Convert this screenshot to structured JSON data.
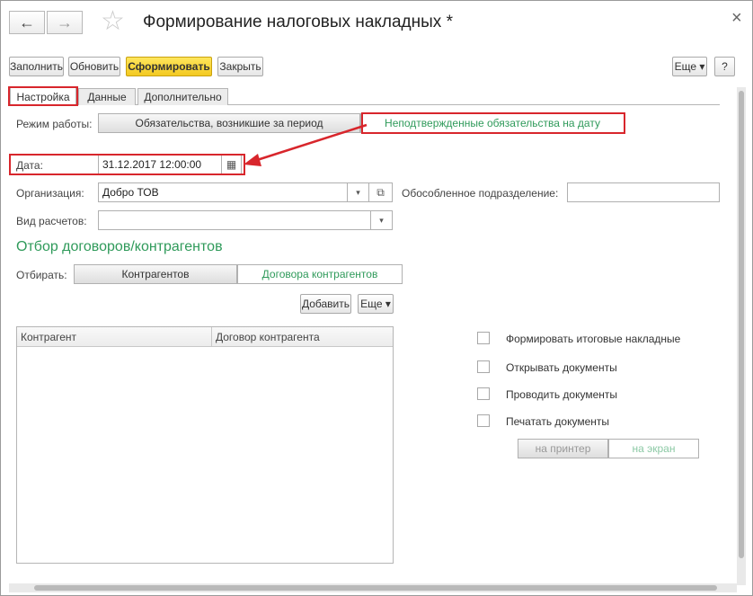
{
  "window": {
    "title": "Формирование налоговых накладных *",
    "close_glyph": "×"
  },
  "nav": {
    "back_glyph": "←",
    "forward_glyph": "→",
    "favorite_glyph": "☆"
  },
  "toolbar": {
    "fill_label": "Заполнить",
    "refresh_label": "Обновить",
    "generate_label": "Сформировать",
    "close_label": "Закрыть",
    "more_label": "Еще ▾",
    "help_label": "?"
  },
  "tabs": [
    {
      "label": "Настройка",
      "active": true
    },
    {
      "label": "Данные",
      "active": false
    },
    {
      "label": "Дополнительно",
      "active": false
    }
  ],
  "form": {
    "mode_label": "Режим работы:",
    "mode_options": [
      "Обязательства, возникшие за период",
      "Неподтвержденные обязательства на дату"
    ],
    "date_label": "Дата:",
    "date_value": "31.12.2017 12:00:00",
    "calendar_icon": "▦",
    "org_label": "Организация:",
    "org_value": "Добро ТОВ",
    "dropdown_glyph": "▾",
    "open_glyph": "⧉",
    "subdivision_label": "Обособленное подразделение:",
    "subdivision_value": "",
    "calc_type_label": "Вид расчетов:",
    "calc_type_value": ""
  },
  "filter": {
    "title": "Отбор договоров/контрагентов",
    "select_label": "Отбирать:",
    "options": [
      "Контрагентов",
      "Договора контрагентов"
    ],
    "add_label": "Добавить",
    "more_label": "Еще ▾",
    "columns": [
      "Контрагент",
      "Договор контрагента"
    ]
  },
  "options": {
    "checkboxes": [
      {
        "label": "Формировать итоговые накладные",
        "checked": false
      },
      {
        "label": "Открывать документы",
        "checked": false
      },
      {
        "label": "Проводить документы",
        "checked": false
      },
      {
        "label": "Печатать документы",
        "checked": false
      }
    ],
    "print_targets": [
      "на принтер",
      "на экран"
    ]
  },
  "colors": {
    "accent_green": "#2f9a5a",
    "primary_yellow": "#f3c921",
    "annotation_red": "#d8262c"
  }
}
